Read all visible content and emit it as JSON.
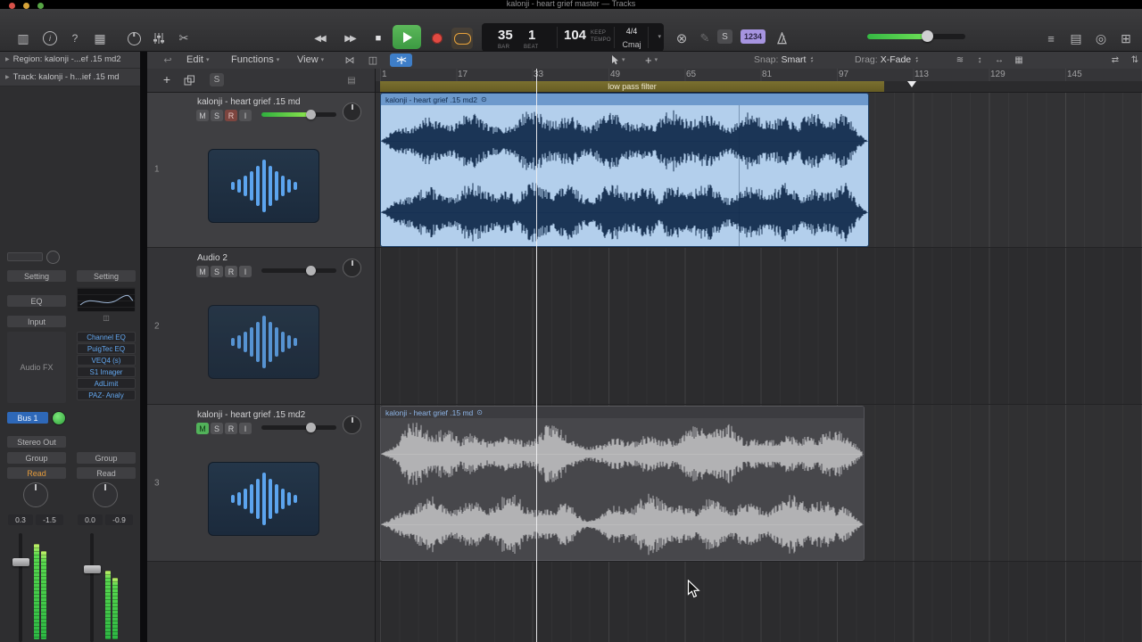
{
  "window": {
    "title": "kalonji - heart grief master — Tracks"
  },
  "colors": {
    "play_green": "#3fae49",
    "record_red": "#e14840",
    "cycle_orange": "#e8a33c",
    "badge_purple": "#a694e0",
    "meter_green": "#42d94e",
    "region_blue": "#b3cfec",
    "plugin_text_blue": "#63a7ef"
  },
  "toolbar": {
    "lcd": {
      "bar": "35",
      "beat": "1",
      "bar_label": "BAR",
      "beat_label": "BEAT",
      "tempo": "104",
      "tempo_mode_top": "KEEP",
      "tempo_mode_bottom": "TEMPO",
      "time_sig": "4/4",
      "key": "Cmaj"
    },
    "solo_label": "S",
    "count_in_label": "1234"
  },
  "menubar": {
    "edit": "Edit",
    "functions": "Functions",
    "view": "View",
    "snap_label": "Snap:",
    "snap_value": "Smart",
    "drag_label": "Drag:",
    "drag_value": "X-Fade"
  },
  "track_header_bar": {
    "add": "+",
    "solo": "S"
  },
  "ruler": {
    "ticks": [
      "1",
      "17",
      "33",
      "49",
      "65",
      "81",
      "97",
      "113",
      "129",
      "145"
    ],
    "marker": "low pass filter"
  },
  "inspector": {
    "region_row": "Region: kalonji -...ef .15 md2",
    "track_row": "Track: kalonji - h...ief .15 md",
    "left_strip": {
      "setting": "Setting",
      "eq": "EQ",
      "input": "Input",
      "audio_fx": "Audio FX",
      "bus": "Bus 1",
      "output": "Stereo Out",
      "group": "Group",
      "automation": "Read",
      "pan": "0.3",
      "volume": "-1.5"
    },
    "right_strip": {
      "setting": "Setting",
      "plugins": [
        "Channel EQ",
        "PuigTec EQ",
        "VEQ4 (s)",
        "S1 Imager",
        "AdLimit",
        "PAZ- Analy"
      ],
      "group": "Group",
      "automation": "Read",
      "pan": "0.0",
      "volume": "-0.9"
    }
  },
  "track_buttons": {
    "m": "M",
    "s": "S",
    "r": "R",
    "i": "I"
  },
  "tracks": [
    {
      "num": "1",
      "name": "kalonji - heart grief .15 md"
    },
    {
      "num": "2",
      "name": "Audio 2"
    },
    {
      "num": "3",
      "name": "kalonji - heart grief .15 md2"
    }
  ],
  "regions": [
    {
      "name": "kalonji - heart grief .15 md2"
    },
    {
      "name": "kalonji - heart grief .15 md"
    }
  ]
}
